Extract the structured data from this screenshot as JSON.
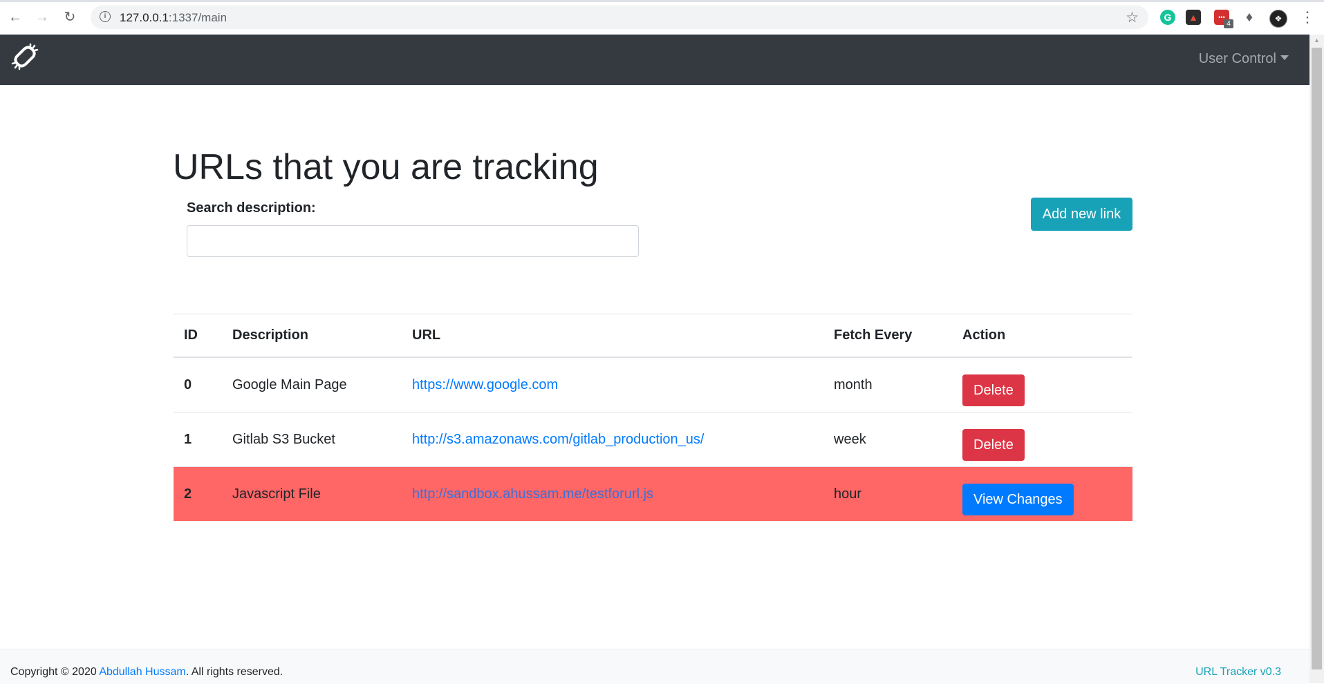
{
  "browser": {
    "url_host": "127.0.0.1",
    "url_rest": ":1337/main",
    "ext_badge": "4"
  },
  "navbar": {
    "user_control": "User Control"
  },
  "main": {
    "title": "URLs that you are tracking",
    "search_label": "Search description:",
    "search_placeholder": "",
    "add_button": "Add new link"
  },
  "table": {
    "headers": [
      "ID",
      "Description",
      "URL",
      "Fetch Every",
      "Action"
    ],
    "rows": [
      {
        "id": "0",
        "description": "Google Main Page",
        "url": "https://www.google.com",
        "fetch": "month",
        "action": "Delete",
        "status": "normal"
      },
      {
        "id": "1",
        "description": "Gitlab S3 Bucket",
        "url": "http://s3.amazonaws.com/gitlab_production_us/",
        "fetch": "week",
        "action": "Delete",
        "status": "normal"
      },
      {
        "id": "2",
        "description": "Javascript File",
        "url": "http://sandbox.ahussam.me/testforurl.js",
        "fetch": "hour",
        "action": "View Changes",
        "status": "changed"
      }
    ]
  },
  "footer": {
    "copyright_prefix": "Copyright © 2020 ",
    "author": "Abdullah Hussam",
    "copyright_suffix": ". All rights reserved.",
    "version": "URL Tracker v0.3"
  },
  "colors": {
    "navbar": "#343a40",
    "accent_info": "#17a2b8",
    "danger": "#dc3545",
    "primary": "#007bff",
    "changed_row": "#ff6666"
  }
}
